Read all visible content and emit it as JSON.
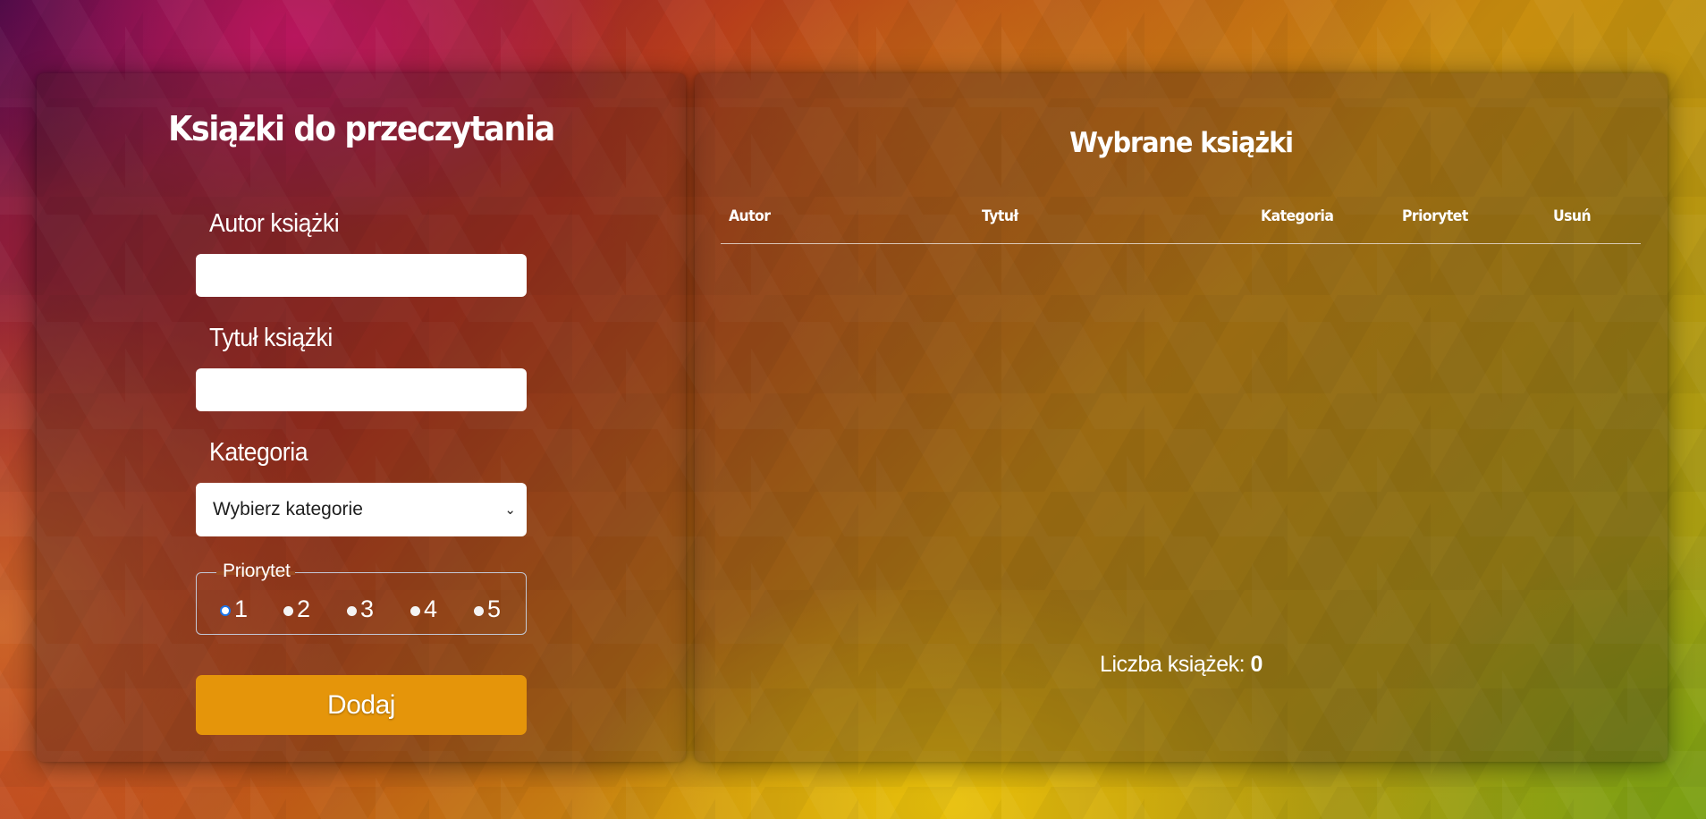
{
  "form": {
    "title": "Książki do przeczytania",
    "author_label": "Autor książki",
    "author_value": "",
    "title_label": "Tytuł książki",
    "title_value": "",
    "category_label": "Kategoria",
    "category_selected": "Wybierz kategorie",
    "priority_legend": "Priorytet",
    "priority_options": [
      "1",
      "2",
      "3",
      "4",
      "5"
    ],
    "priority_selected": "1",
    "add_button": "Dodaj"
  },
  "list": {
    "title": "Wybrane książki",
    "columns": [
      "Autor",
      "Tytuł",
      "Kategoria",
      "Priorytet",
      "Usuń"
    ],
    "rows": [],
    "count_label": "Liczba książek:",
    "count_value": "0"
  },
  "colors": {
    "button": "#e5950a",
    "input_background": "#ffffff",
    "radio_selected": "#1a73e8"
  },
  "icons": {
    "select_arrow": "chevron-down-icon"
  }
}
